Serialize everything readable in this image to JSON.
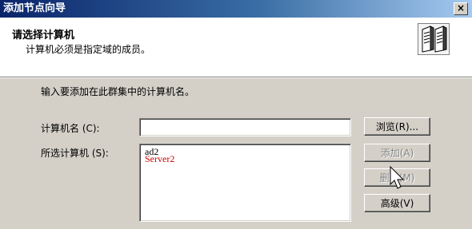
{
  "window": {
    "title": "添加节点向导",
    "close_glyph": "×"
  },
  "header": {
    "heading": "请选择计算机",
    "subtitle": "计算机必须是指定域的成员。",
    "icon": "computers-icon"
  },
  "main": {
    "instruction": "输入要添加在此群集中的计算机名。",
    "computer_name_label": "计算机名 (C):",
    "computer_name_value": "",
    "selected_label": "所选计算机 (S):",
    "selected_computers": [
      "ad2",
      "Server2"
    ]
  },
  "buttons": {
    "browse": "浏览(R)...",
    "add": "添加(A)",
    "remove": "删除(M)",
    "advanced": "高级(V)"
  },
  "colors": {
    "title_gradient_start": "#0a246a",
    "title_gradient_end": "#a6caf0",
    "dialog_face": "#d4d0c8",
    "selected_item_red": "#cc0000"
  }
}
